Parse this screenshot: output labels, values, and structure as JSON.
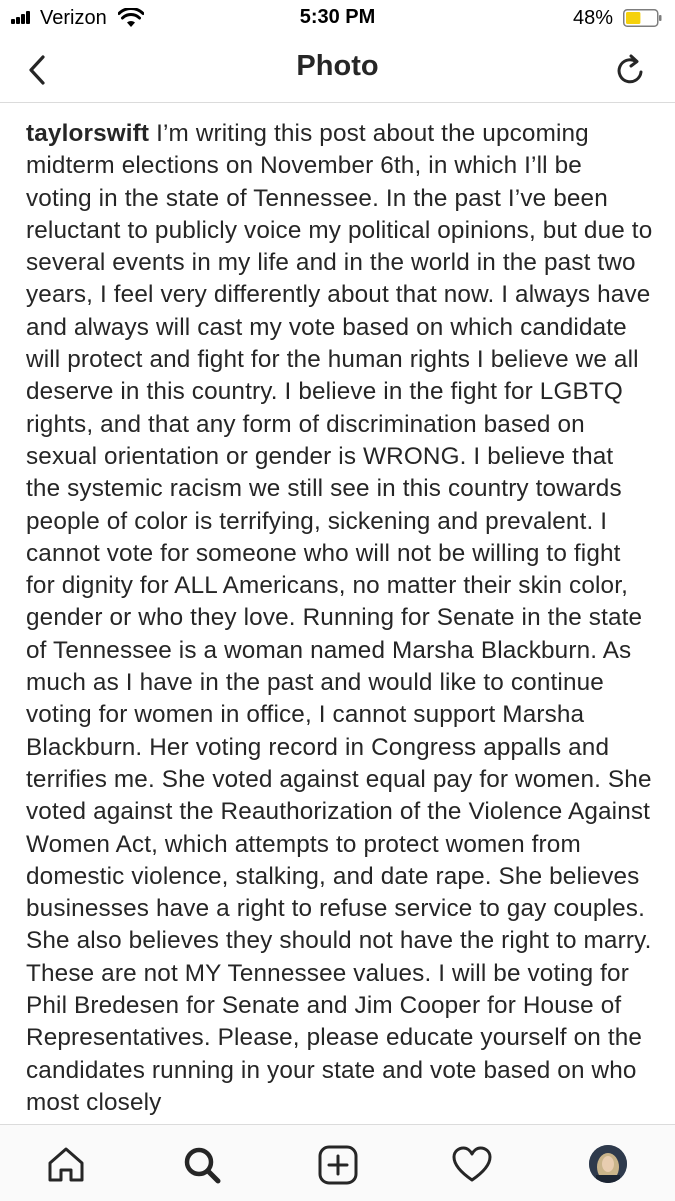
{
  "status_bar": {
    "carrier": "Verizon",
    "time": "5:30 PM",
    "battery_percent": "48%",
    "battery_level": 0.48
  },
  "header": {
    "title": "Photo"
  },
  "caption": {
    "username": "taylorswift",
    "text": "I’m writing this post about the upcoming midterm elections on November 6th, in which I’ll be voting in the state of Tennessee. In the past I’ve been reluctant to publicly voice my political opinions, but due to several events in my life and in the world in the past two years, I feel very differently about that now.  I always have and always will cast my vote based on which candidate will protect and fight for the human rights I believe we all deserve in this country. I believe in the fight for LGBTQ rights, and that any form of discrimination based on sexual orientation or gender is WRONG. I believe that the systemic racism we still see in this country towards people of color is terrifying, sickening and prevalent. I cannot vote for someone who will not be willing to fight for dignity for ALL Americans, no matter their skin color, gender or who they love.  Running for Senate in the state of Tennessee is a woman named Marsha Blackburn. As much as I have in the past and would like to continue voting for women in office, I cannot support Marsha Blackburn. Her voting record in Congress appalls and terrifies me. She voted against equal pay for women. She voted against the Reauthorization of the Violence Against Women Act, which attempts to protect women from domestic violence, stalking, and date rape. She believes businesses have a right to refuse service to gay couples. She also believes they should not have the right to marry. These are not MY Tennessee values. I will be voting for Phil Bredesen for Senate and Jim Cooper for House of Representatives.  Please, please educate yourself on the candidates running in your state and vote based on who most closely"
  },
  "tab_bar": {
    "tabs": [
      {
        "icon": "home-icon"
      },
      {
        "icon": "search-icon",
        "active": true
      },
      {
        "icon": "new-post-icon"
      },
      {
        "icon": "heart-icon"
      },
      {
        "icon": "profile-avatar"
      }
    ]
  },
  "colors": {
    "text": "#262626",
    "divider": "#dbdbdb",
    "battery": "#f5d10b"
  }
}
